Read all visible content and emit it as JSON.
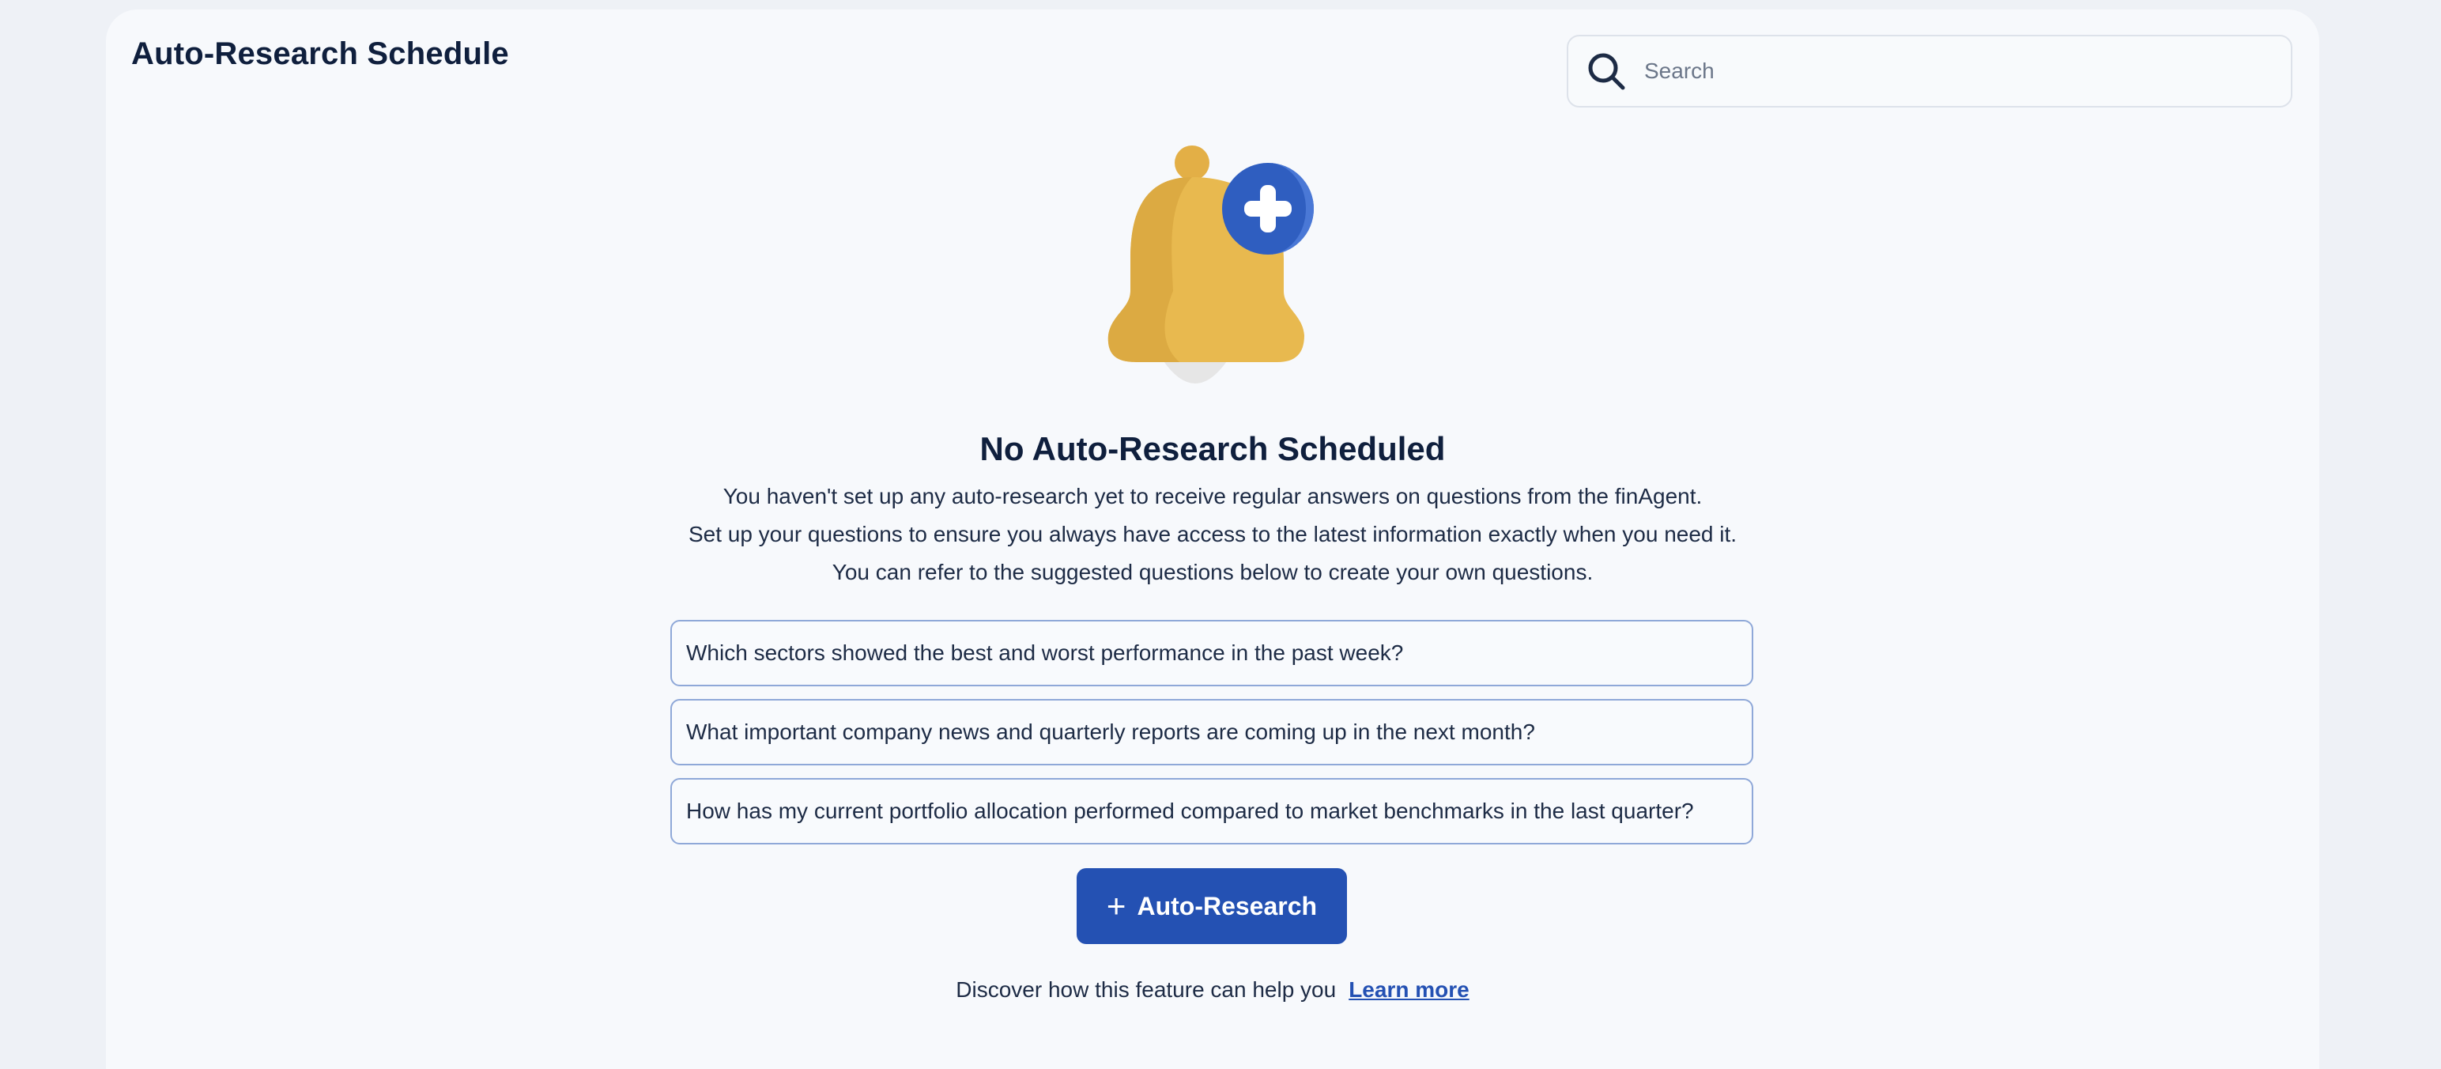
{
  "header": {
    "title": "Auto-Research Schedule"
  },
  "search": {
    "placeholder": "Search",
    "value": ""
  },
  "empty_state": {
    "title": "No Auto-Research Scheduled",
    "description_lines": [
      "You haven't set up any auto-research yet to receive regular answers on questions from the finAgent.",
      "Set up your questions to ensure you always have access to the latest information exactly when you need it.",
      "You can refer to the suggested questions below to create your own questions."
    ],
    "illustration_icon": "bell-with-plus-icon"
  },
  "suggestions": [
    "Which sectors showed the best and worst performance in the past week?",
    "What important company news and quarterly reports are coming up in the next month?",
    "How has my current portfolio allocation performed compared to market benchmarks in the last quarter?"
  ],
  "actions": {
    "add_button_icon": "+",
    "add_button_label": "Auto-Research"
  },
  "footer": {
    "text": "Discover how this feature can help you",
    "link_label": "Learn more"
  },
  "colors": {
    "accent": "#2451b3",
    "bell": "#e8b94f",
    "bell_shade": "#dcaa42",
    "background": "#eef1f6",
    "panel": "#f7f9fc"
  }
}
